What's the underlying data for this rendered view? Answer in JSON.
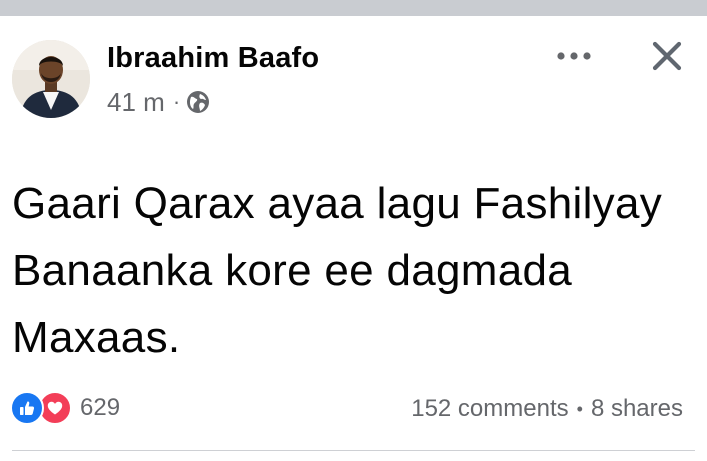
{
  "post": {
    "author": {
      "name": "Ibraahim Baafo"
    },
    "time": "41 m",
    "separator": "·",
    "privacy_icon": "globe-icon",
    "text": "Gaari Qarax ayaa lagu Fashilyay Banaanka kore ee dagmada Maxaas.",
    "header_icons": {
      "more": "more-options-icon",
      "close": "close-icon"
    }
  },
  "engagement": {
    "reaction_icons": [
      "like-icon",
      "love-icon"
    ],
    "reaction_count": "629",
    "comments": "152 comments",
    "stats_separator": "•",
    "shares": "8 shares"
  },
  "colors": {
    "top_strip": "#c9ccd1",
    "text_primary": "#050505",
    "text_secondary": "#65676b",
    "like_blue": "#1877f2",
    "love_red": "#f33e58",
    "divider": "#ced0d4"
  }
}
